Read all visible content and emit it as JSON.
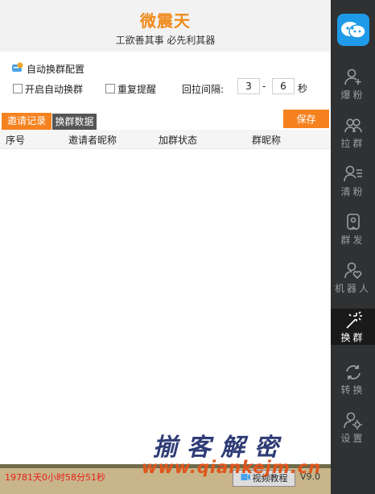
{
  "app": {
    "title": "微震天",
    "slogan": "工欲善其事 必先利其器"
  },
  "config": {
    "section_title": "自动换群配置",
    "auto_switch_label": "开启自动换群",
    "repeat_remind_label": "重复提醒",
    "interval_label": "回拉间隔:",
    "interval_from": "3",
    "interval_dash": "-",
    "interval_to": "6",
    "interval_unit": "秒",
    "save_label": "保存"
  },
  "tabs": [
    {
      "label": "邀请记录",
      "active": true
    },
    {
      "label": "换群数据",
      "active": false
    }
  ],
  "table": {
    "columns": [
      "序号",
      "邀请者昵称",
      "加群状态",
      "群昵称"
    ],
    "rows": []
  },
  "footer": {
    "timer": "19781天0小时58分51秒",
    "video_label": "视频教程",
    "version": "V9.0"
  },
  "watermark": {
    "text": "揃客解密",
    "url": "www.qiankejm.cn"
  },
  "sidebar": {
    "items": [
      {
        "label": "爆粉",
        "icon": "add-user-icon"
      },
      {
        "label": "拉群",
        "icon": "group-icon"
      },
      {
        "label": "清粉",
        "icon": "user-list-icon"
      },
      {
        "label": "群发",
        "icon": "send-message-icon"
      },
      {
        "label": "机器人",
        "icon": "heart-user-icon"
      },
      {
        "label": "换群",
        "icon": "magic-wand-icon",
        "active": true
      },
      {
        "label": "转换",
        "icon": "refresh-icon"
      },
      {
        "label": "设置",
        "icon": "user-settings-icon"
      }
    ]
  },
  "colors": {
    "accent": "#f5821f",
    "title": "#f08a1c",
    "sidebar_bg": "#2f3133",
    "timer": "#e8201a"
  }
}
